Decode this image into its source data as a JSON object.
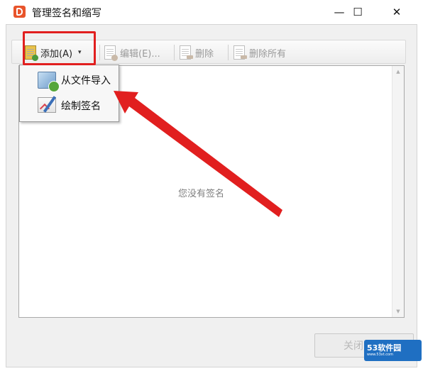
{
  "window": {
    "title": "管理签名和缩写",
    "minimize_label": "—",
    "maximize_label": "☐",
    "close_label": "✕"
  },
  "toolbar": {
    "add_label": "添加(A)",
    "edit_label": "编辑(E)...",
    "delete_label": "删除",
    "delete_all_label": "删除所有",
    "add_caret": "▾"
  },
  "add_menu": {
    "items": [
      {
        "label": "从文件导入",
        "icon": "image-import-icon"
      },
      {
        "label": "绘制签名",
        "icon": "draw-signature-icon"
      }
    ]
  },
  "list": {
    "empty_message": "您没有签名"
  },
  "scrollbar": {
    "up_arrow": "▲",
    "down_arrow": "▼"
  },
  "footer": {
    "close_button_label": "关闭"
  },
  "watermark": {
    "brand": "53软件园",
    "url": "www.53xt.com"
  },
  "colors": {
    "annotation_red": "#e11f1f",
    "app_icon": "#e8542b"
  }
}
